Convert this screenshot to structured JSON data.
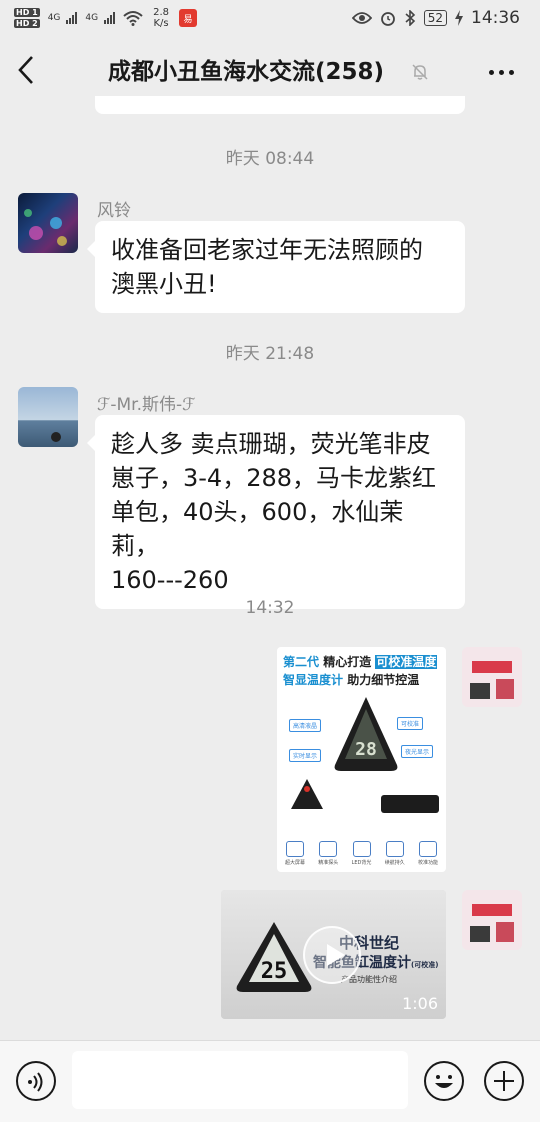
{
  "status_bar": {
    "sim1": "HD 1",
    "sim2": "HD 2",
    "net1": "4G",
    "net2": "4G",
    "speed_value": "2.8",
    "speed_unit": "K/s",
    "battery": "52",
    "time": "14:36",
    "icons": [
      "signal-icon",
      "wifi-icon",
      "eye-icon",
      "alarm-icon",
      "bluetooth-icon",
      "battery-icon",
      "charging-icon"
    ]
  },
  "header": {
    "title": "成都小丑鱼海水交流(258)",
    "back_icon": "chevron-left-icon",
    "mute_icon": "bell-off-icon",
    "more_icon": "more-dots-icon"
  },
  "messages": [
    {
      "timestamp": "昨天 08:44",
      "sender": "风铃",
      "text_line1": "收准备回老家过年无法照顾的",
      "text_line2": "澳黑小丑!"
    },
    {
      "timestamp": "昨天 21:48",
      "sender": "ℱ-Mr.斯伟-ℱ",
      "text_line1": "趁人多 卖点珊瑚，荧光笔非皮",
      "text_line2": "崽子，3-4，288，马卡龙紫红",
      "text_line3": "单包，40头，600，水仙茉莉，",
      "text_line4": "160---260"
    }
  ],
  "outgoing": {
    "timestamp": "14:32",
    "image": {
      "line1_a": "第二代",
      "line1_b": "精心打造",
      "line1_c": "可校准温度",
      "line2_a": "智显温度计",
      "line2_b": "助力细节控温",
      "reading": "28",
      "features": [
        "超大屏幕",
        "精准探头",
        "LED背光",
        "续航持久",
        "校准功能"
      ]
    },
    "video": {
      "title": "中科世纪",
      "subtitle": "智能鱼缸温度计",
      "subtitle_note": "(可校准)",
      "caption": "产品功能性介绍",
      "reading": "25",
      "duration": "1:06"
    }
  },
  "input_bar": {
    "placeholder": "",
    "voice_icon": "voice-icon",
    "emoji_icon": "emoji-icon",
    "plus_icon": "plus-icon"
  },
  "colors": {
    "background": "#ededed",
    "bubble": "#ffffff",
    "timestamp": "#8a8a8a",
    "accent_blue": "#1a8fd0"
  }
}
